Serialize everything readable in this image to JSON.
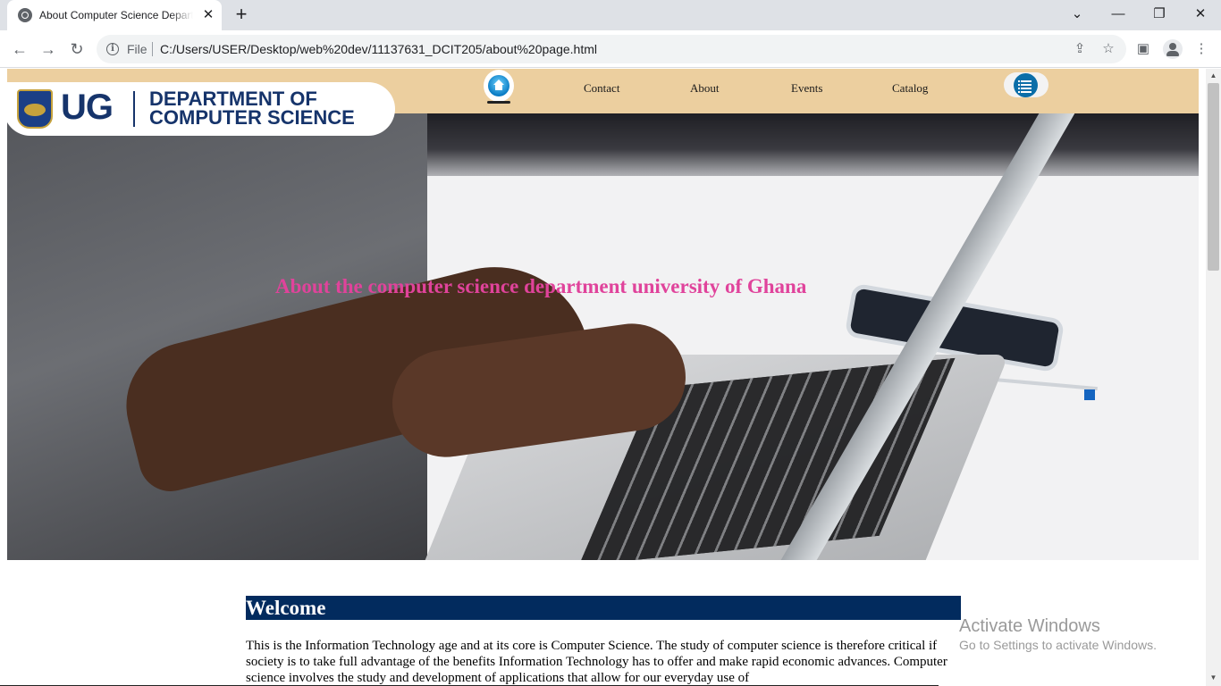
{
  "browser": {
    "tab_title": "About Computer Science Department",
    "tab_close": "✕",
    "new_tab": "+",
    "scheme": "File",
    "url": "C:/Users/USER/Desktop/web%20dev/11137631_DCIT205/about%20page.html",
    "nav": {
      "back": "←",
      "forward": "→",
      "reload": "↻"
    },
    "window": {
      "chevron": "⌄",
      "minimize": "—",
      "restore": "❐",
      "close": "✕"
    },
    "icons": {
      "share": "⇪",
      "star": "☆",
      "side_panel": "▣",
      "menu": "⋮"
    }
  },
  "navbar": {
    "home_icon": "home-icon",
    "links": [
      {
        "label": "Contact"
      },
      {
        "label": "About"
      },
      {
        "label": "Events"
      },
      {
        "label": "Catalog"
      }
    ],
    "menu_icon": "list-icon",
    "background_color": "#eccf9f"
  },
  "logo": {
    "abbr": "UG",
    "line1": "DEPARTMENT OF",
    "line2": "COMPUTER SCIENCE",
    "color": "#16346b"
  },
  "hero": {
    "title": "About the computer science department university of Ghana",
    "title_color": "#e0439b"
  },
  "welcome": {
    "heading": "Welcome",
    "heading_bg": "#022b5e",
    "body": "This is the Information Technology age and at its core is Computer Science. The study of computer science is therefore critical if society is to take full advantage of the benefits Information Technology has to offer and make rapid economic advances. Computer science involves the study and development of applications that allow for our everyday use of"
  },
  "watermark": {
    "title": "Activate Windows",
    "subtitle": "Go to Settings to activate Windows."
  }
}
